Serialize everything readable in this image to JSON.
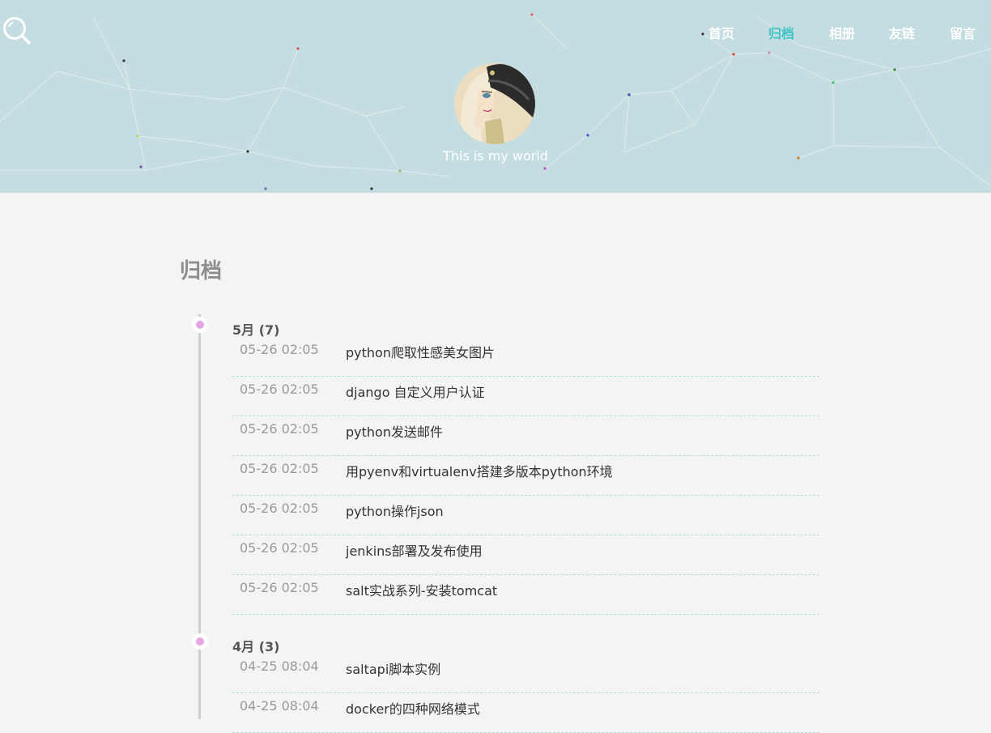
{
  "nav": {
    "items": [
      {
        "label": "首页",
        "active": false
      },
      {
        "label": "归档",
        "active": true
      },
      {
        "label": "相册",
        "active": false
      },
      {
        "label": "友链",
        "active": false
      },
      {
        "label": "留言",
        "active": false
      }
    ]
  },
  "header": {
    "tagline": "This is my world",
    "background_color": "#c4dde0",
    "search_icon": "search-icon"
  },
  "archive": {
    "title": "归档",
    "groups": [
      {
        "month_label": "5月 (7)",
        "posts": [
          {
            "date": "05-26 02:05",
            "title": "python爬取性感美女图片"
          },
          {
            "date": "05-26 02:05",
            "title": "django 自定义用户认证"
          },
          {
            "date": "05-26 02:05",
            "title": "python发送邮件"
          },
          {
            "date": "05-26 02:05",
            "title": "用pyenv和virtualenv搭建多版本python环境"
          },
          {
            "date": "05-26 02:05",
            "title": "python操作json"
          },
          {
            "date": "05-26 02:05",
            "title": "jenkins部署及发布使用"
          },
          {
            "date": "05-26 02:05",
            "title": "salt实战系列-安装tomcat"
          }
        ]
      },
      {
        "month_label": "4月 (3)",
        "posts": [
          {
            "date": "04-25 08:04",
            "title": "saltapi脚本实例"
          },
          {
            "date": "04-25 08:04",
            "title": "docker的四种网络模式"
          }
        ]
      }
    ]
  },
  "colors": {
    "active_nav": "#3ec3c6",
    "timeline_dot": "#e4a6e4",
    "row_divider": "#b6dcd4"
  }
}
